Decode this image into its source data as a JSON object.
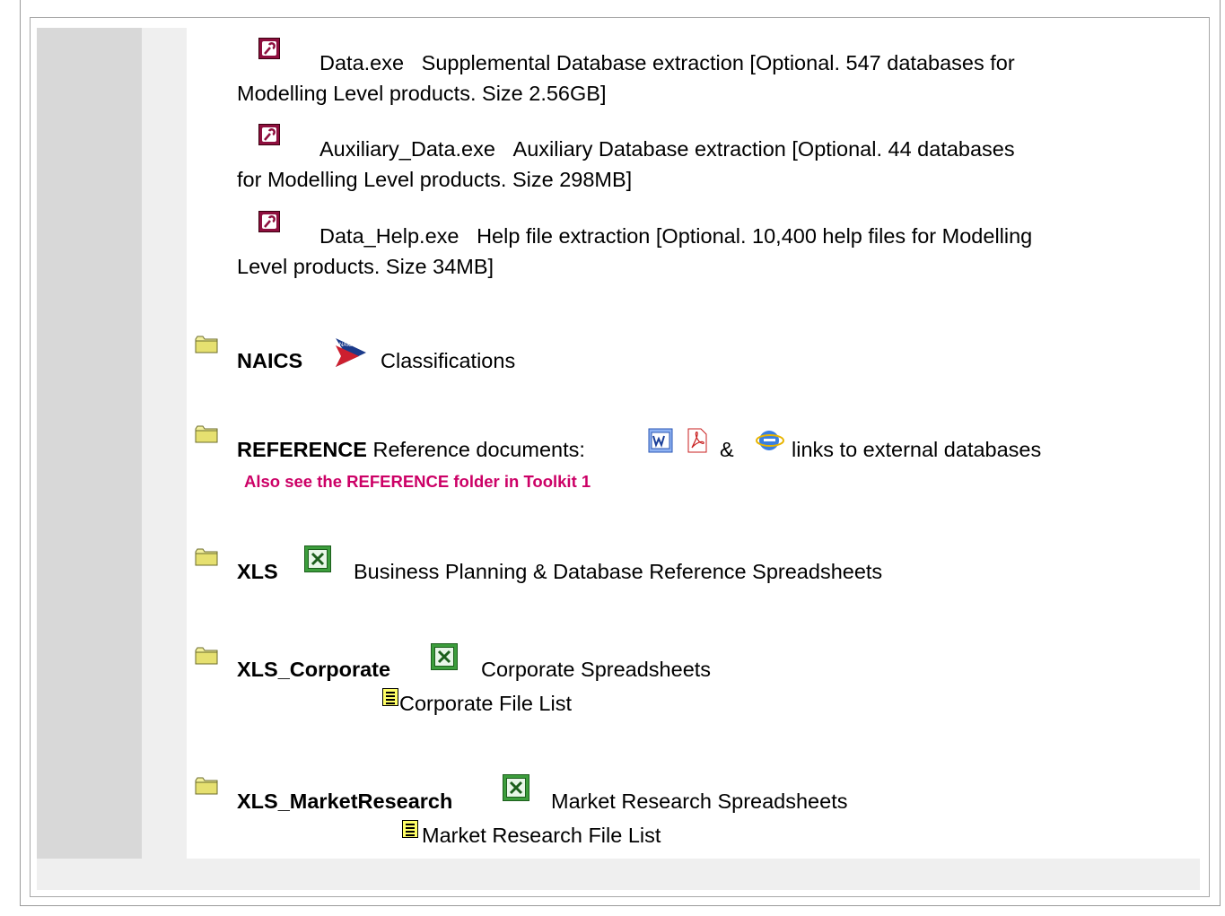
{
  "items": {
    "data_exe": {
      "name": "Data.exe",
      "desc_line1": "Supplemental Database extraction [Optional. 547 databases for",
      "desc_line2": "Modelling Level products. Size 2.56GB]"
    },
    "aux_exe": {
      "name": "Auxiliary_Data.exe",
      "desc_line1": "Auxiliary Database extraction [Optional. 44 databases",
      "desc_line2": "for Modelling Level products. Size 298MB]"
    },
    "help_exe": {
      "name": "Data_Help.exe",
      "desc_line1": "Help file extraction [Optional. 10,400 help files for Modelling",
      "desc_line2": "Level products. Size 34MB]"
    }
  },
  "folders": {
    "naics": {
      "name": "NAICS",
      "desc": "Classifications",
      "logo_text": "NAICS"
    },
    "reference": {
      "name": "REFERENCE",
      "desc_before": "Reference documents:",
      "amp": "&",
      "desc_after": "links to external databases",
      "note": "Also see the REFERENCE folder in Toolkit 1"
    },
    "xls": {
      "name": "XLS",
      "desc": "Business Planning & Database Reference Spreadsheets"
    },
    "xls_corporate": {
      "name": "XLS_Corporate",
      "desc": "Corporate Spreadsheets",
      "file_list": "Corporate File List"
    },
    "xls_marketresearch": {
      "name": "XLS_MarketResearch",
      "desc": "Market Research Spreadsheets",
      "file_list": "Market Research File List"
    }
  },
  "colors": {
    "pink_note": "#cc0066",
    "gray_column": "#d8d8d8",
    "light_column": "#efefef"
  },
  "icons": {
    "exe": "access-key-icon",
    "folder": "folder-icon",
    "excel": "excel-icon",
    "word": "word-icon",
    "pdf": "pdf-icon",
    "ie": "internet-explorer-icon",
    "text_file": "text-file-icon"
  }
}
